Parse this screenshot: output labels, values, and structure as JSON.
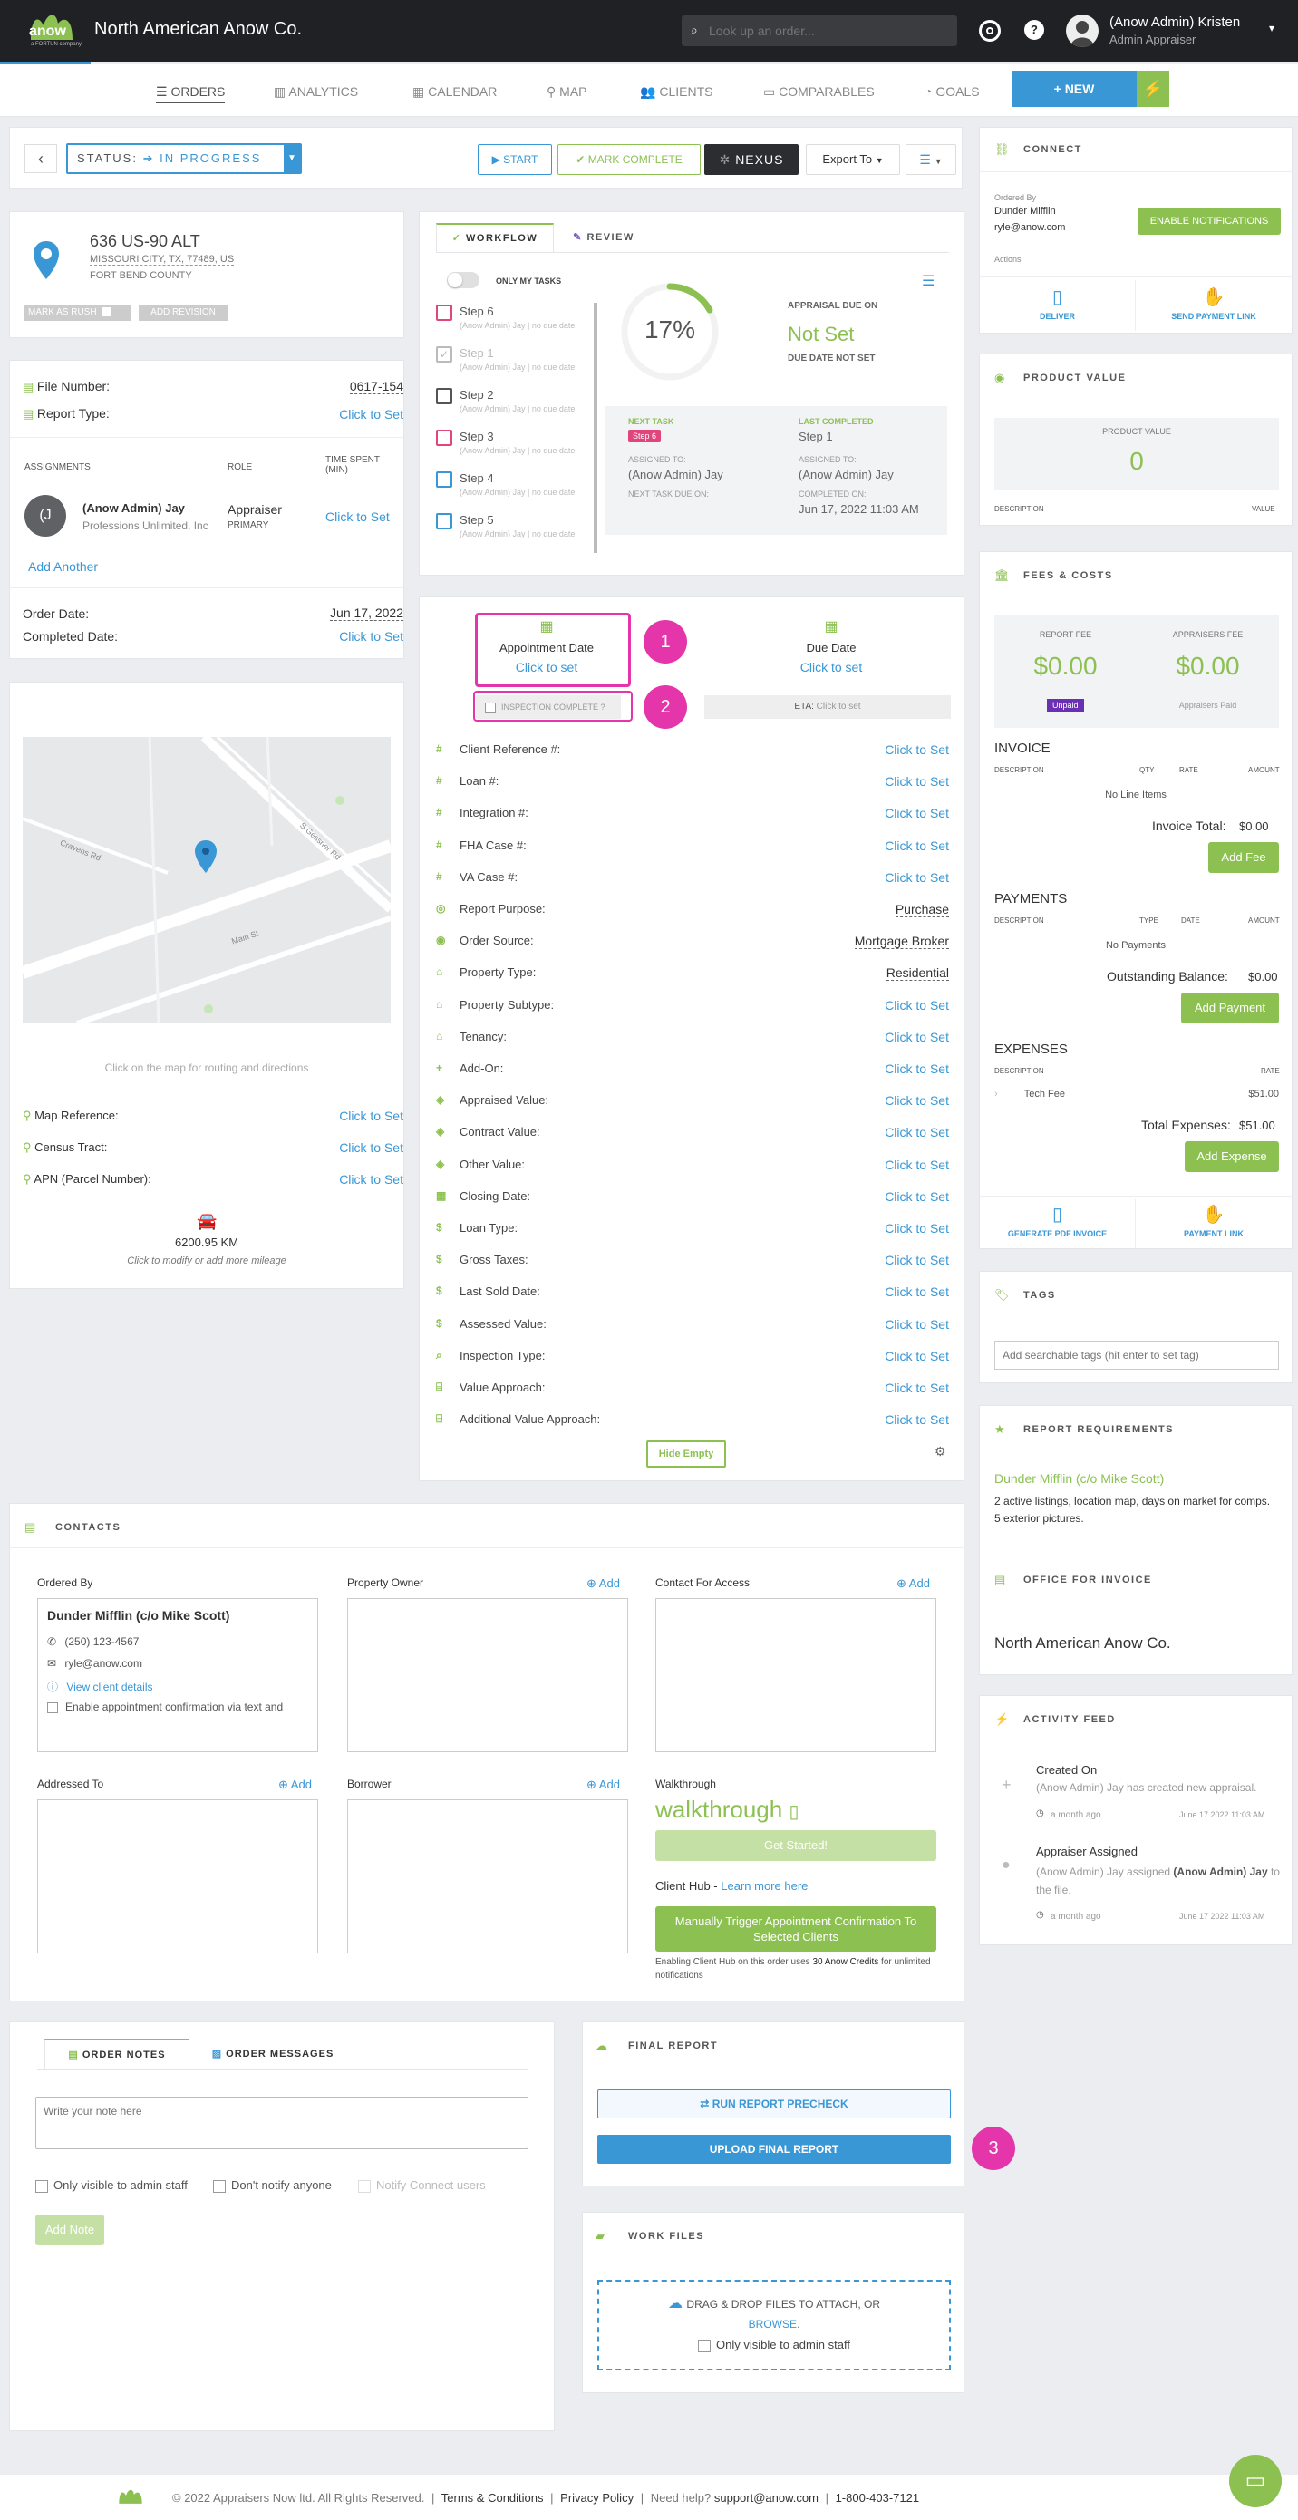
{
  "header": {
    "brand": "North American Anow Co.",
    "logo_text": "anow",
    "logo_sub": "a FORTUN company",
    "search_placeholder": "Look up an order...",
    "user_name": "(Anow Admin) Kristen",
    "user_role": "Admin Appraiser"
  },
  "nav": {
    "items": [
      "ORDERS",
      "ANALYTICS",
      "CALENDAR",
      "MAP",
      "CLIENTS",
      "COMPARABLES",
      "GOALS"
    ],
    "new_label": "+ NEW"
  },
  "toolbar": {
    "status_label": "STATUS:",
    "status_value": "IN PROGRESS",
    "start": "START",
    "mark_complete": "MARK COMPLETE",
    "nexus": "NEXUS",
    "export": "Export To"
  },
  "property": {
    "address": "636 US-90 ALT",
    "city_line": "MISSOURI CITY, TX, 77489, US",
    "county": "FORT BEND COUNTY",
    "rush": "MARK AS RUSH",
    "revision": "ADD REVISION"
  },
  "file": {
    "file_number_label": "File Number:",
    "file_number": "0617-154",
    "report_type_label": "Report Type:",
    "report_type": "Click to Set",
    "assign_h": "ASSIGNMENTS",
    "role_h": "ROLE",
    "time_h": "TIME SPENT (MIN)",
    "assignee": "(Anow Admin) Jay",
    "company": "Professions Unlimited, Inc",
    "role": "Appraiser",
    "primary": "PRIMARY",
    "time": "Click to Set",
    "avatar_letter": "(J",
    "add_another": "Add Another",
    "order_date_label": "Order Date:",
    "order_date": "Jun 17, 2022",
    "completed_label": "Completed Date:",
    "completed": "Click to Set"
  },
  "map": {
    "hint": "Click on the map for routing and directions",
    "streets": [
      "Cravens Rd",
      "Main St",
      "S Gessner Rd"
    ],
    "fields": [
      {
        "label": "Map Reference:",
        "value": "Click to Set"
      },
      {
        "label": "Census Tract:",
        "value": "Click to Set"
      },
      {
        "label": "APN (Parcel Number):",
        "value": "Click to Set"
      }
    ],
    "distance": "6200.95 KM",
    "distance_hint": "Click to modify or add more mileage"
  },
  "workflow": {
    "tab1": "WORKFLOW",
    "tab2": "REVIEW",
    "only_my": "ONLY MY TASKS",
    "percent": "17%",
    "percent_value": 0.17,
    "steps": [
      {
        "name": "Step 6",
        "sub": "(Anow Admin) Jay | no due date",
        "color": "#e0467c",
        "done": false
      },
      {
        "name": "Step 1",
        "sub": "(Anow Admin) Jay | no due date",
        "color": "#bbb",
        "done": true
      },
      {
        "name": "Step 2",
        "sub": "(Anow Admin) Jay | no due date",
        "color": "#555",
        "done": false
      },
      {
        "name": "Step 3",
        "sub": "(Anow Admin) Jay | no due date",
        "color": "#e0467c",
        "done": false
      },
      {
        "name": "Step 4",
        "sub": "(Anow Admin) Jay | no due date",
        "color": "#3a97d6",
        "done": false
      },
      {
        "name": "Step 5",
        "sub": "(Anow Admin) Jay | no due date",
        "color": "#3a97d6",
        "done": false
      }
    ],
    "due_label": "APPRAISAL DUE ON",
    "due_value": "Not Set",
    "due_sub": "DUE DATE NOT SET",
    "next_task_h": "NEXT TASK",
    "next_task": "Step 6",
    "last_h": "LAST COMPLETED",
    "last": "Step 1",
    "assigned_h": "ASSIGNED TO:",
    "assigned": "(Anow Admin) Jay",
    "assigned2_h": "ASSIGNED TO:",
    "assigned2": "(Anow Admin) Jay",
    "next_due_h": "NEXT TASK DUE ON:",
    "completed_on_h": "COMPLETED ON:",
    "completed_on": "Jun 17, 2022 11:03 AM"
  },
  "details": {
    "appt_label": "Appointment Date",
    "appt_value": "Click to set",
    "due_label": "Due Date",
    "due_value": "Click to set",
    "inspection": "INSPECTION COMPLETE ?",
    "eta_label": "ETA:",
    "eta_value": "Click to set",
    "fields": [
      {
        "icon": "#",
        "label": "Client Reference #:",
        "value": "Click to Set",
        "set": false
      },
      {
        "icon": "#",
        "label": "Loan #:",
        "value": "Click to Set",
        "set": false
      },
      {
        "icon": "#",
        "label": "Integration #:",
        "value": "Click to Set",
        "set": false
      },
      {
        "icon": "#",
        "label": "FHA Case #:",
        "value": "Click to Set",
        "set": false
      },
      {
        "icon": "#",
        "label": "VA Case #:",
        "value": "Click to Set",
        "set": false
      },
      {
        "icon": "◎",
        "label": "Report Purpose:",
        "value": "Purchase",
        "set": true
      },
      {
        "icon": "◉",
        "label": "Order Source:",
        "value": "Mortgage Broker",
        "set": true
      },
      {
        "icon": "⌂",
        "label": "Property Type:",
        "value": "Residential",
        "set": true
      },
      {
        "icon": "⌂",
        "label": "Property Subtype:",
        "value": "Click to Set",
        "set": false
      },
      {
        "icon": "⌂",
        "label": "Tenancy:",
        "value": "Click to Set",
        "set": false
      },
      {
        "icon": "+",
        "label": "Add-On:",
        "value": "Click to Set",
        "set": false
      },
      {
        "icon": "◈",
        "label": "Appraised Value:",
        "value": "Click to Set",
        "set": false
      },
      {
        "icon": "◈",
        "label": "Contract Value:",
        "value": "Click to Set",
        "set": false
      },
      {
        "icon": "◈",
        "label": "Other Value:",
        "value": "Click to Set",
        "set": false
      },
      {
        "icon": "▦",
        "label": "Closing Date:",
        "value": "Click to Set",
        "set": false
      },
      {
        "icon": "$",
        "label": "Loan Type:",
        "value": "Click to Set",
        "set": false
      },
      {
        "icon": "$",
        "label": "Gross Taxes:",
        "value": "Click to Set",
        "set": false
      },
      {
        "icon": "$",
        "label": "Last Sold Date:",
        "value": "Click to Set",
        "set": false
      },
      {
        "icon": "$",
        "label": "Assessed Value:",
        "value": "Click to Set",
        "set": false
      },
      {
        "icon": "⌕",
        "label": "Inspection Type:",
        "value": "Click to Set",
        "set": false
      },
      {
        "icon": "⌸",
        "label": "Value Approach:",
        "value": "Click to Set",
        "set": false
      },
      {
        "icon": "⌸",
        "label": "Additional Value Approach:",
        "value": "Click to Set",
        "set": false
      }
    ],
    "hide_empty": "Hide Empty"
  },
  "connect": {
    "title": "CONNECT",
    "ordered_by": "Ordered By",
    "client": "Dunder Mifflin",
    "email": "ryle@anow.com",
    "enable": "ENABLE NOTIFICATIONS",
    "actions": "Actions",
    "deliver": "DELIVER",
    "send_link": "SEND PAYMENT LINK"
  },
  "product": {
    "title": "PRODUCT VALUE",
    "box_label": "PRODUCT VALUE",
    "value": "0",
    "desc_h": "DESCRIPTION",
    "value_h": "VALUE"
  },
  "fees": {
    "title": "FEES & COSTS",
    "report_fee_h": "REPORT FEE",
    "report_fee": "$0.00",
    "unpaid": "Unpaid",
    "appraiser_fee_h": "APPRAISERS FEE",
    "appraiser_fee": "$0.00",
    "appraiser_paid": "Appraisers Paid",
    "invoice_h": "INVOICE",
    "cols": [
      "DESCRIPTION",
      "QTY",
      "RATE",
      "AMOUNT"
    ],
    "no_items": "No Line Items",
    "invoice_total_label": "Invoice Total:",
    "invoice_total": "$0.00",
    "add_fee": "Add Fee",
    "payments_h": "PAYMENTS",
    "pay_cols": [
      "DESCRIPTION",
      "TYPE",
      "DATE",
      "AMOUNT"
    ],
    "no_payments": "No Payments",
    "outstanding_label": "Outstanding Balance:",
    "outstanding": "$0.00",
    "add_payment": "Add Payment",
    "expenses_h": "EXPENSES",
    "exp_cols": [
      "DESCRIPTION",
      "RATE"
    ],
    "expense_name": "Tech Fee",
    "expense_rate": "$51.00",
    "total_exp_label": "Total Expenses:",
    "total_exp": "$51.00",
    "add_expense": "Add Expense",
    "gen_pdf": "GENERATE PDF INVOICE",
    "pay_link": "PAYMENT LINK"
  },
  "tags": {
    "title": "TAGS",
    "placeholder": "Add searchable tags (hit enter to set tag)"
  },
  "requirements": {
    "title": "REPORT REQUIREMENTS",
    "client": "Dunder Mifflin (c/o Mike Scott)",
    "text": "2 active listings, location map, days on market for comps. 5 exterior pictures."
  },
  "office": {
    "title": "OFFICE FOR INVOICE",
    "value": "North American Anow Co."
  },
  "activity": {
    "title": "ACTIVITY FEED",
    "items": [
      {
        "title": "Created On",
        "text": "(Anow Admin) Jay has created new appraisal.",
        "ago": "a month ago",
        "date": "June 17 2022 11:03 AM"
      },
      {
        "title": "Appraiser Assigned",
        "text_pre": "(Anow Admin) Jay assigned ",
        "text_bold": "(Anow Admin) Jay",
        "text_post": " to the file.",
        "ago": "a month ago",
        "date": "June 17 2022 11:03 AM"
      }
    ]
  },
  "contacts": {
    "title": "CONTACTS",
    "ordered_by": "Ordered By",
    "client": "Dunder Mifflin (c/o Mike Scott)",
    "phone": "(250) 123-4567",
    "email": "ryle@anow.com",
    "view": "View client details",
    "enable_sms": "Enable appointment confirmation via text and",
    "owner": "Property Owner",
    "access": "Contact For Access",
    "addressed": "Addressed To",
    "borrower": "Borrower",
    "add": "Add",
    "walkthrough_h": "Walkthrough",
    "walkthrough_logo": "walkthrough",
    "get_started": "Get Started!",
    "hub_label": "Client Hub -",
    "hub_link": "Learn more here",
    "trigger": "Manually Trigger Appointment Confirmation To Selected Clients",
    "hub_note_pre": "Enabling Client Hub on this order uses ",
    "hub_note_bold": "30 Anow Credits",
    "hub_note_post": " for unlimited notifications"
  },
  "notes": {
    "tab1": "ORDER NOTES",
    "tab2": "ORDER MESSAGES",
    "placeholder": "Write your note here",
    "opt1": "Only visible to admin staff",
    "opt2": "Don't notify anyone",
    "opt3": "Notify Connect users",
    "add": "Add Note"
  },
  "final": {
    "title": "FINAL REPORT",
    "precheck": "RUN REPORT PRECHECK",
    "upload": "UPLOAD FINAL REPORT"
  },
  "work": {
    "title": "WORK FILES",
    "drop": "DRAG & DROP FILES TO ATTACH, OR",
    "browse": "BROWSE.",
    "visible": "Only visible to admin staff"
  },
  "annotations": [
    "1",
    "2",
    "3"
  ],
  "footer": {
    "copyright": "© 2022 Appraisers Now ltd. All Rights Reserved.",
    "terms": "Terms & Conditions",
    "privacy": "Privacy Policy",
    "help": "Need help?",
    "support": "support@anow.com",
    "phone": "1-800-403-7121"
  }
}
